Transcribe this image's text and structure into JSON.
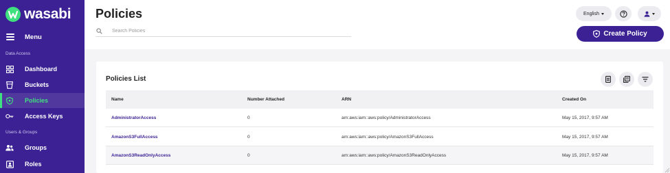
{
  "brand": {
    "name": "wasabi",
    "accent": "#3b2193",
    "active_color": "#3fe07f"
  },
  "sidebar": {
    "menu_label": "Menu",
    "sections": [
      {
        "label": "Data Access"
      },
      {
        "label": "Users & Groups"
      }
    ],
    "items": [
      {
        "label": "Dashboard",
        "icon": "dashboard-icon",
        "active": false
      },
      {
        "label": "Buckets",
        "icon": "bucket-icon",
        "active": false
      },
      {
        "label": "Policies",
        "icon": "shield-icon",
        "active": true
      },
      {
        "label": "Access Keys",
        "icon": "key-icon",
        "active": false
      },
      {
        "label": "Groups",
        "icon": "groups-icon",
        "active": false
      },
      {
        "label": "Roles",
        "icon": "roles-icon",
        "active": false
      }
    ]
  },
  "header": {
    "title": "Policies",
    "search_placeholder": "Search Policies",
    "language": "English",
    "create_label": "Create Policy"
  },
  "policies": {
    "title": "Policies List",
    "columns": [
      "Name",
      "Number Attached",
      "ARN",
      "Created On"
    ],
    "rows": [
      {
        "name": "AdministratorAccess",
        "attached": "0",
        "arn": "arn:aws:iam::aws:policy/AdministratorAccess",
        "created": "May 15, 2017, 9:57 AM"
      },
      {
        "name": "AmazonS3FullAccess",
        "attached": "0",
        "arn": "arn:aws:iam::aws:policy/AmazonS3FullAccess",
        "created": "May 15, 2017, 9:57 AM"
      },
      {
        "name": "AmazonS3ReadOnlyAccess",
        "attached": "0",
        "arn": "arn:aws:iam::aws:policy/AmazonS3ReadOnlyAccess",
        "created": "May 15, 2017, 9:57 AM"
      }
    ]
  }
}
